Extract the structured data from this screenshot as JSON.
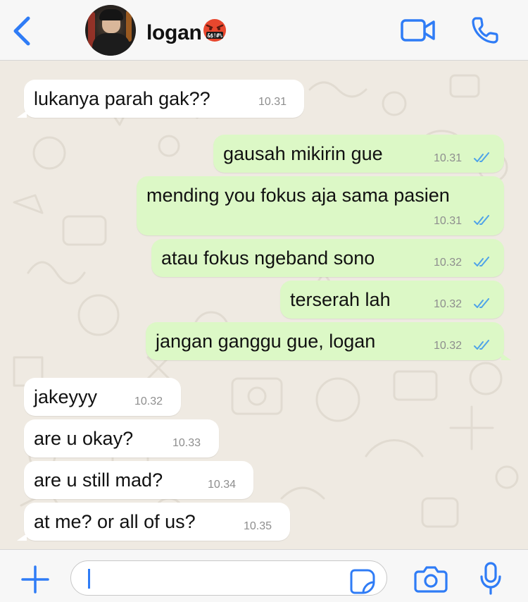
{
  "header": {
    "contact_name": "logan",
    "name_emoji": "&$!#%"
  },
  "messages": [
    {
      "direction": "in",
      "text": "lukanya parah gak??",
      "time": "10.31"
    },
    {
      "direction": "out",
      "text": "gausah mikirin gue",
      "time": "10.31",
      "status": "read"
    },
    {
      "direction": "out",
      "text": "mending you fokus aja sama pasien",
      "time": "10.31",
      "status": "read"
    },
    {
      "direction": "out",
      "text": "atau fokus ngeband sono",
      "time": "10.32",
      "status": "read"
    },
    {
      "direction": "out",
      "text": "terserah lah",
      "time": "10.32",
      "status": "read"
    },
    {
      "direction": "out",
      "text": "jangan ganggu gue, logan",
      "time": "10.32",
      "status": "read"
    },
    {
      "direction": "in",
      "text": "jakeyyy",
      "time": "10.32"
    },
    {
      "direction": "in",
      "text": "are u okay?",
      "time": "10.33"
    },
    {
      "direction": "in",
      "text": "are u still mad?",
      "time": "10.34"
    },
    {
      "direction": "in",
      "text": "at me? or all of us?",
      "time": "10.35"
    }
  ],
  "composer": {
    "value": ""
  },
  "icons": {
    "back": "chevron-left-icon",
    "video": "video-camera-icon",
    "call": "phone-icon",
    "plus": "plus-icon",
    "sticker": "sticker-icon",
    "camera": "camera-icon",
    "mic": "microphone-icon"
  },
  "colors": {
    "accent": "#2f7cf6",
    "outgoing_bubble": "#dcf8c6",
    "incoming_bubble": "#ffffff",
    "wallpaper": "#efeae2",
    "read_ticks": "#4fa3e8",
    "emoji_face": "#e8472e"
  }
}
